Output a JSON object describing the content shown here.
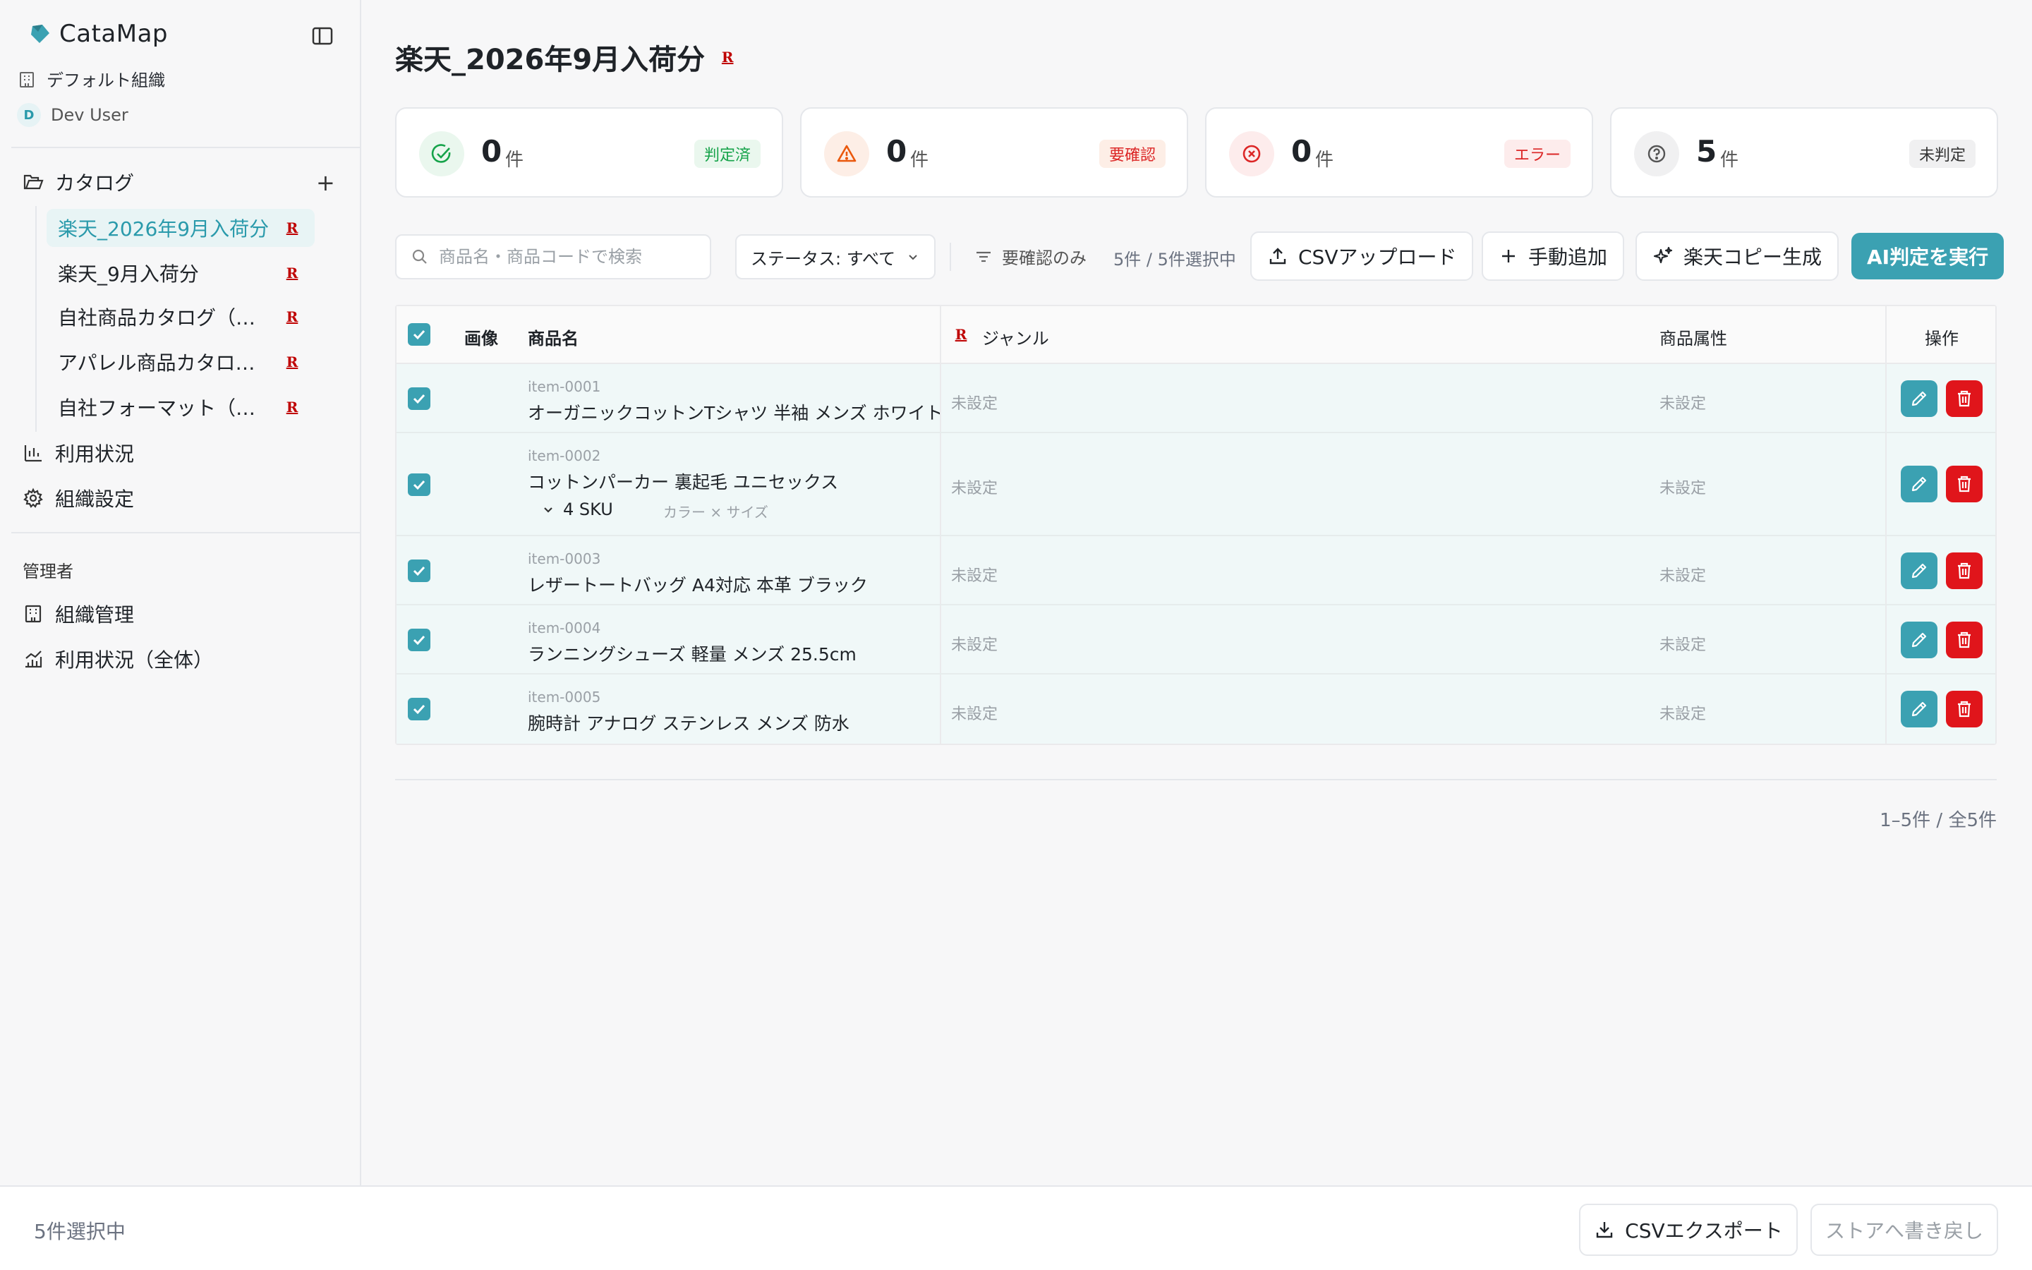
{
  "brand": {
    "name": "CataMap",
    "logo_icon": "catamap-logo-icon"
  },
  "sidebar": {
    "org_name": "デフォルト組織",
    "user_initial": "D",
    "user_name": "Dev User",
    "catalog_label": "カタログ",
    "add_label": "+",
    "catalogs": [
      {
        "label": "楽天_2026年9月入荷分",
        "badge": "R",
        "active": true
      },
      {
        "label": "楽天_9月入荷分",
        "badge": "R",
        "active": false
      },
      {
        "label": "自社商品カタログ（…",
        "badge": "R",
        "active": false
      },
      {
        "label": "アパレル商品カタロ…",
        "badge": "R",
        "active": false
      },
      {
        "label": "自社フォーマット（…",
        "badge": "R",
        "active": false
      }
    ],
    "usage_label": "利用状況",
    "org_settings_label": "組織設定",
    "admin_section": "管理者",
    "org_admin_label": "組織管理",
    "usage_all_label": "利用状況（全体）"
  },
  "page": {
    "title": "楽天_2026年9月入荷分",
    "title_badge": "R"
  },
  "stats": [
    {
      "count": "0",
      "unit": "件",
      "badge": "判定済",
      "icon": "check-circle-icon",
      "color": "#16a34a",
      "bg": "#eaf7ee",
      "badge_bg": "#eaf7ee"
    },
    {
      "count": "0",
      "unit": "件",
      "badge": "要確認",
      "icon": "warning-icon",
      "color": "#ea580c",
      "bg": "#fdeee6",
      "badge_bg": "#fdeee6"
    },
    {
      "count": "0",
      "unit": "件",
      "badge": "エラー",
      "icon": "x-circle-icon",
      "color": "#dc2626",
      "bg": "#fdecec",
      "badge_bg": "#fdecec"
    },
    {
      "count": "5",
      "unit": "件",
      "badge": "未判定",
      "icon": "question-circle-icon",
      "color": "#555555",
      "bg": "#f0f0f1",
      "badge_bg": "#f0f0f1"
    }
  ],
  "toolbar": {
    "search_placeholder": "商品名・商品コードで検索",
    "status_select": "ステータス: すべて",
    "filter_label": "要確認のみ",
    "selection_count": "5件 / 5件選択中",
    "csv_upload": "CSVアップロード",
    "manual_add": "手動追加",
    "rakuten_copy": "楽天コピー生成",
    "ai_run": "AI判定を実行"
  },
  "table": {
    "headers": {
      "image": "画像",
      "name": "商品名",
      "genre": "ジャンル",
      "genre_badge": "R",
      "attributes": "商品属性",
      "actions": "操作"
    },
    "rows": [
      {
        "code": "item-0001",
        "name": "オーガニックコットンTシャツ 半袖 メンズ ホワイト",
        "genre": "未設定",
        "attr": "未設定"
      },
      {
        "code": "item-0002",
        "name": "コットンパーカー 裏起毛 ユニセックス",
        "genre": "未設定",
        "attr": "未設定",
        "sku": "4 SKU",
        "sku_attrs": "カラー × サイズ"
      },
      {
        "code": "item-0003",
        "name": "レザートートバッグ A4対応 本革 ブラック",
        "genre": "未設定",
        "attr": "未設定"
      },
      {
        "code": "item-0004",
        "name": "ランニングシューズ 軽量 メンズ 25.5cm",
        "genre": "未設定",
        "attr": "未設定"
      },
      {
        "code": "item-0005",
        "name": "腕時計 アナログ ステンレス メンズ 防水",
        "genre": "未設定",
        "attr": "未設定"
      }
    ]
  },
  "pagination": "1–5件 / 全5件",
  "footer": {
    "selected": "5件選択中",
    "export": "CSVエクスポート",
    "writeback": "ストアへ書き戻し"
  },
  "colors": {
    "accent": "#3ba1b2",
    "danger": "#e0151b",
    "rakuten": "#bf0000"
  }
}
